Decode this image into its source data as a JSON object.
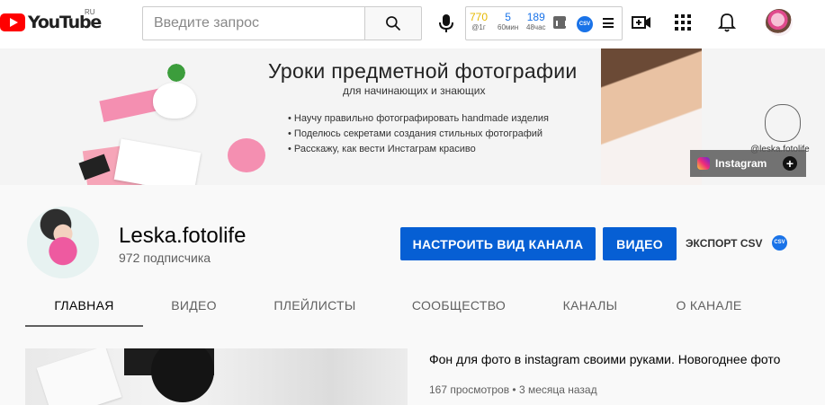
{
  "header": {
    "logo_text": "YouTube",
    "logo_region": "RU",
    "search_placeholder": "Введите запрос",
    "stats": [
      {
        "value": "770",
        "label": "@1г"
      },
      {
        "value": "5",
        "label": "60мин"
      },
      {
        "value": "189",
        "label": "48час"
      }
    ],
    "extension_badge": "CSV"
  },
  "banner": {
    "title": "Уроки предметной фотографии",
    "subtitle": "для начинающих и знающих",
    "bullets": [
      "Научу правильно фотографировать handmade изделия",
      "Поделюсь секретами создания стильных фотографий",
      "Расскажу, как вести Инстаграм красиво"
    ],
    "handle": "@leska.fotolife",
    "instagram_label": "Instagram"
  },
  "channel": {
    "name": "Leska.fotolife",
    "subscribers": "972 подписчика",
    "customize_button": "НАСТРОИТЬ ВИД КАНАЛА",
    "video_button": "ВИДЕО",
    "export_label": "ЭКСПОРТ CSV",
    "tabs": [
      "ГЛАВНАЯ",
      "ВИДЕО",
      "ПЛЕЙЛИСТЫ",
      "СООБЩЕСТВО",
      "КАНАЛЫ",
      "О КАНАЛЕ"
    ],
    "active_tab": "ГЛАВНАЯ"
  },
  "featured_video": {
    "title": "Фон для фото в instagram своими руками. Новогоднее фото",
    "meta": "167 просмотров • 3 месяца назад"
  },
  "colors": {
    "brand_red": "#ff0000",
    "accent_blue": "#065fd4"
  }
}
